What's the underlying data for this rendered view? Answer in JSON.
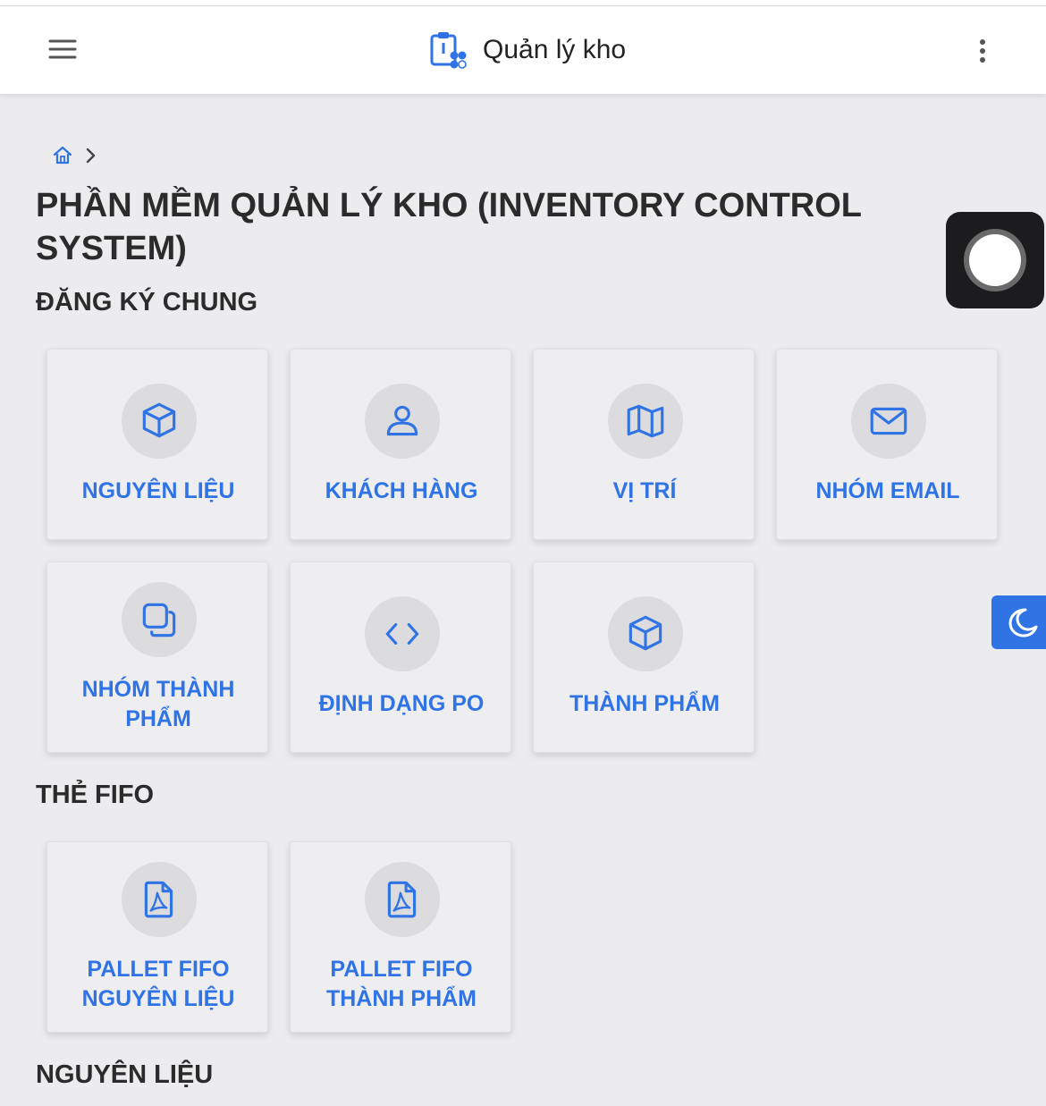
{
  "app_bar": {
    "title": "Quản lý kho",
    "menu_icon": "hamburger-menu-icon",
    "logo_icon": "clipboard-inventory-icon",
    "more_icon": "kebab-menu-icon"
  },
  "breadcrumb": {
    "home_icon": "home-icon",
    "separator_icon": "chevron-right-icon"
  },
  "page_title": "PHẦN MỀM QUẢN LÝ KHO (INVENTORY CONTROL SYSTEM)",
  "sections": [
    {
      "title": "ĐĂNG KÝ CHUNG",
      "cards": [
        {
          "label": "NGUYÊN LIỆU",
          "icon": "cube-icon"
        },
        {
          "label": "KHÁCH HÀNG",
          "icon": "user-icon"
        },
        {
          "label": "VỊ TRÍ",
          "icon": "map-icon"
        },
        {
          "label": "NHÓM EMAIL",
          "icon": "envelope-icon"
        },
        {
          "label": "NHÓM THÀNH\nPHẨM",
          "icon": "stacked-squares-icon"
        },
        {
          "label": "ĐỊNH DẠNG PO",
          "icon": "code-icon"
        },
        {
          "label": "THÀNH PHẨM",
          "icon": "cube-icon"
        }
      ]
    },
    {
      "title": "THẺ FIFO",
      "cards": [
        {
          "label": "PALLET FIFO\nNGUYÊN LIỆU",
          "icon": "pdf-file-icon"
        },
        {
          "label": "PALLET FIFO\nTHÀNH PHẨM",
          "icon": "pdf-file-icon"
        }
      ]
    },
    {
      "title": "NGUYÊN LIỆU",
      "cards": []
    }
  ],
  "floating": {
    "assistive_icon": "assistive-touch-icon",
    "theme_icon": "moon-icon"
  },
  "colors": {
    "accent": "#2f73e5",
    "background": "#ececef",
    "card": "#eeeef1",
    "icon_circle": "#dcdcdf"
  }
}
